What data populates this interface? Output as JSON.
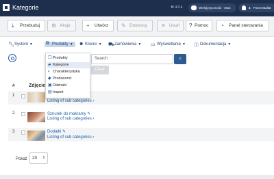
{
  "app": {
    "title": "Kategorie",
    "version": "⌘ 4.0.4"
  },
  "topbar": {
    "accessibility_label": "Wielojęzyczność - Stan",
    "notifications_count": "4",
    "installer_label": "Post Installat"
  },
  "toolbar": {
    "save": "Przebuduj",
    "actions": "Akcje",
    "create": "Utwórz",
    "adjust": "Dostosuj",
    "delete": "Usuń",
    "help": "Pomoc",
    "control_panel": "Panel sterowania"
  },
  "menu": {
    "system": "System",
    "products": "Produkty",
    "clients": "Klienci",
    "orders": "Zamówienia",
    "display": "Wyświetlanie",
    "documentation": "Dokumentacja"
  },
  "dropdown": [
    {
      "label": "Produkty",
      "icon": "cube-icon"
    },
    {
      "label": "Kategorie",
      "icon": "folder-icon"
    },
    {
      "label": "Charakterystyka",
      "icon": "half-circle-icon"
    },
    {
      "label": "Producenci",
      "icon": "tag-icon"
    },
    {
      "label": "Odznaki",
      "icon": "badge-icon"
    },
    {
      "label": "Import",
      "icon": "file-icon"
    }
  ],
  "search": {
    "placeholder": "Search",
    "clear_label": "Clear"
  },
  "table": {
    "col_hash": "#",
    "col_image": "Zdjęcie",
    "rows": [
      {
        "num": "1",
        "name": "",
        "sub": "Listing of sub categories"
      },
      {
        "num": "2",
        "name": "Sznurek do makramy",
        "sub": "Listing of sub categories"
      },
      {
        "num": "3",
        "name": "Dodatki",
        "sub": "Listing of sub categories"
      }
    ]
  },
  "pagination": {
    "label": "Pokaż",
    "value": "20"
  },
  "colors": {
    "topbar": "#1d2f4d",
    "accent": "#1f5fa8",
    "link": "#1f5fa8"
  }
}
